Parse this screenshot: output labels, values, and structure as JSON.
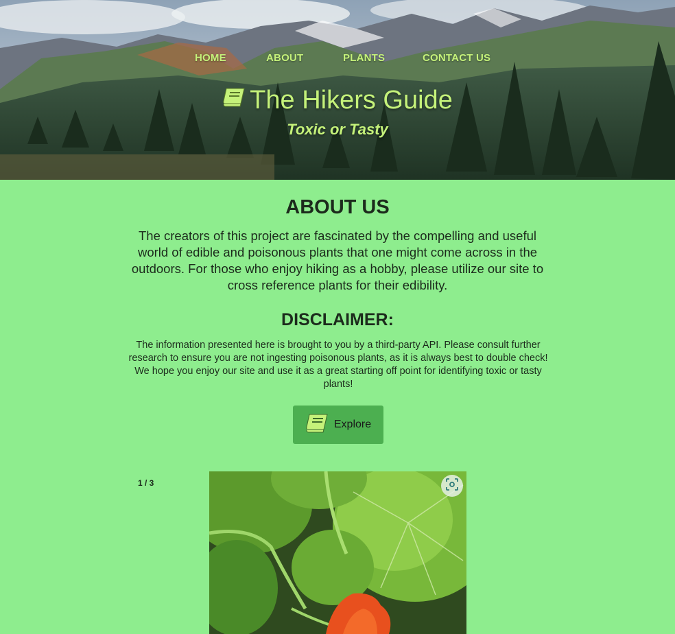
{
  "nav": {
    "items": [
      {
        "label": "HOME"
      },
      {
        "label": "ABOUT"
      },
      {
        "label": "PLANTS"
      },
      {
        "label": "CONTACT US"
      }
    ]
  },
  "hero": {
    "title": "The Hikers Guide",
    "tagline": "Toxic or Tasty",
    "icon": "book-icon"
  },
  "about": {
    "title": "ABOUT US",
    "text": "The creators of this project are fascinated by the compelling and useful world of edible and poisonous plants that one might come across in the outdoors. For those who enjoy hiking as a hobby, please utilize our site to cross reference plants for their edibility."
  },
  "disclaimer": {
    "title": "DISCLAIMER:",
    "text": "The information presented here is brought to you by a third-party API. Please consult further research to ensure you are not ingesting poisonous plants, as it is always best to double check! We hope you enjoy our site and use it as a great starting off point for identifying toxic or tasty plants!"
  },
  "explore": {
    "label": "Explore",
    "icon": "book-icon"
  },
  "slideshow": {
    "counter": "1 / 3",
    "lens_icon": "visual-search-icon"
  },
  "colors": {
    "page_bg": "#8eed8e",
    "accent_text": "#c5f27a",
    "button_bg": "#4caf50"
  }
}
